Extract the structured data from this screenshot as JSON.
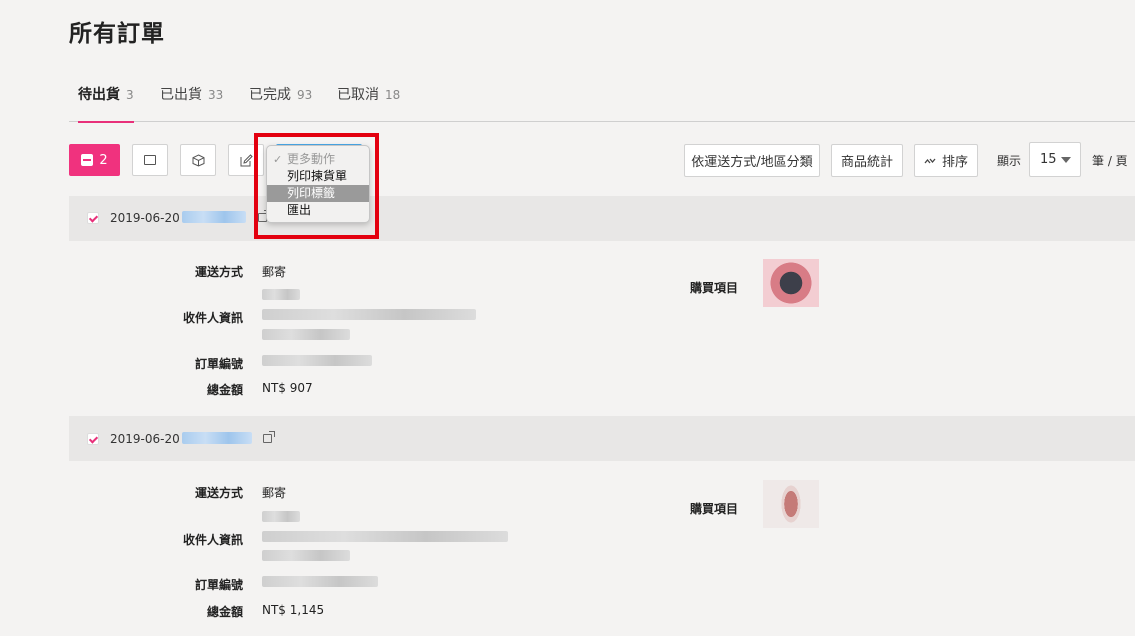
{
  "page": {
    "title": "所有訂單"
  },
  "tabs": [
    {
      "label": "待出貨",
      "count": "3",
      "active": true
    },
    {
      "label": "已出貨",
      "count": "33",
      "active": false
    },
    {
      "label": "已完成",
      "count": "93",
      "active": false
    },
    {
      "label": "已取消",
      "count": "18",
      "active": false
    }
  ],
  "toolbar": {
    "selected_count": "2",
    "group_button": "依運送方式/地區分類",
    "stats_button": "商品統計",
    "sort_button": "排序",
    "display_label": "顯示",
    "per_page_value": "15",
    "per_page_unit": "筆 / 頁"
  },
  "more_actions_menu": {
    "header": "更多動作",
    "items": [
      "列印揀貨單",
      "列印標籤",
      "匯出"
    ],
    "highlighted": "列印標籤"
  },
  "orders": [
    {
      "date": "2019-06-20",
      "shipping_label": "運送方式",
      "shipping_value": "郵寄",
      "recipient_label": "收件人資訊",
      "order_no_label": "訂單編號",
      "total_label": "總金額",
      "total_value": "NT$ 907",
      "items_label": "購買項目"
    },
    {
      "date": "2019-06-20",
      "shipping_label": "運送方式",
      "shipping_value": "郵寄",
      "recipient_label": "收件人資訊",
      "order_no_label": "訂單編號",
      "total_label": "總金額",
      "total_value": "NT$ 1,145",
      "items_label": "購買項目"
    }
  ],
  "colors": {
    "accent": "#f0327e",
    "highlight_box": "#e3000f"
  }
}
